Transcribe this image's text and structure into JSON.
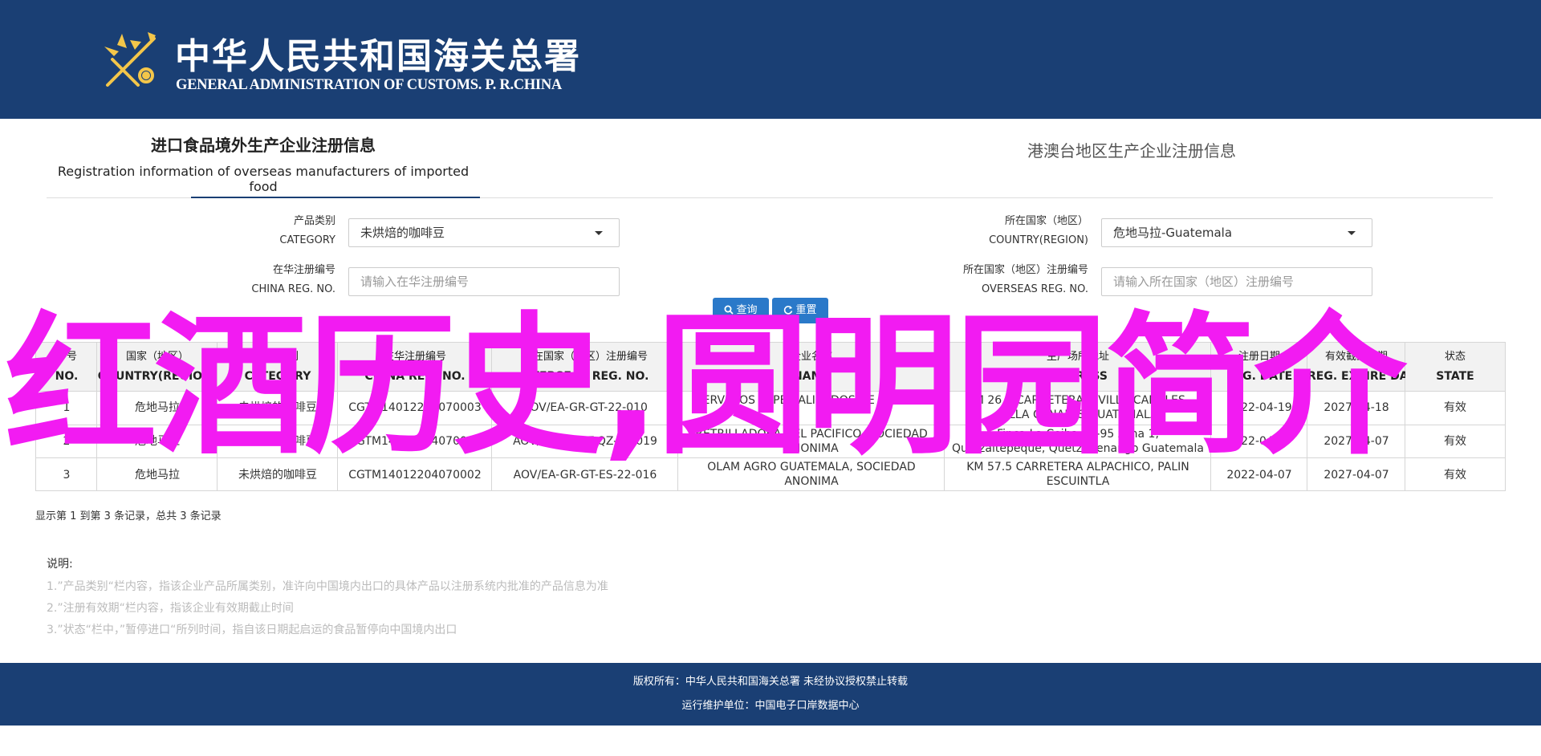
{
  "header": {
    "title_cn": "中华人民共和国海关总署",
    "title_en": "GENERAL ADMINISTRATION OF CUSTOMS. P. R.CHINA",
    "emblem_icon": "customs-emblem-icon"
  },
  "tabs": [
    {
      "label_cn": "进口食品境外生产企业注册信息",
      "label_en": "Registration information of overseas manufacturers of imported food"
    },
    {
      "label_cn": "港澳台地区生产企业注册信息"
    }
  ],
  "form": {
    "category": {
      "label_cn": "产品类别",
      "label_en": "CATEGORY",
      "value": "未烘焙的咖啡豆"
    },
    "country": {
      "label_cn": "所在国家（地区）",
      "label_en": "COUNTRY(REGION)",
      "value": "危地马拉-Guatemala"
    },
    "china_reg": {
      "label_cn": "在华注册编号",
      "label_en": "CHINA REG. NO.",
      "placeholder": "请输入在华注册编号"
    },
    "overseas_reg": {
      "label_cn": "所在国家（地区）注册编号",
      "label_en": "OVERSEAS REG. NO.",
      "placeholder": "请输入所在国家（地区）注册编号"
    },
    "search_label": "查询",
    "reset_label": "重置"
  },
  "table": {
    "headers": [
      {
        "cn": "序号",
        "en": "NO."
      },
      {
        "cn": "国家（地区）",
        "en": "COUNTRY(REGION)"
      },
      {
        "cn": "产品类别",
        "en": "CATEGORY"
      },
      {
        "cn": "在华注册编号",
        "en": "CHINA REG. NO."
      },
      {
        "cn": "所在国家（地区）注册编号",
        "en": "OVERSEAS REG. NO."
      },
      {
        "cn": "企业名称",
        "en": "NAME"
      },
      {
        "cn": "生产场所地址",
        "en": "ADDRESS"
      },
      {
        "cn": "注册日期",
        "en": "REG. DATE"
      },
      {
        "cn": "有效截止日期",
        "en": "REG. EXPIRE DATE"
      },
      {
        "cn": "状态",
        "en": "STATE"
      }
    ],
    "rows": [
      [
        "1",
        "危地马拉",
        "未烘焙的咖啡豆",
        "CGTM14012204070003",
        "AOV/EA-GR-GT-22-010",
        "SERVICIOS ESPECIALIZADOS DE AFIANZA",
        "KM 26.5 CARRETERA A VILLA CANALES, VILLA CANALES GUATEMALA",
        "2022-04-19",
        "2027-04-18",
        "有效"
      ],
      [
        "2",
        "危地马拉",
        "未烘焙的咖啡豆",
        "CGTM14012204070001",
        "AOV/ET-GR-GT-QZ-22-019",
        "RETRILLADORA DEL PACIFICO, SOCIEDAD ANONIMA",
        "Finca La Ceiba 25-95 zona 1, Quetzaltepeque, Quetzaltenango Guatemala",
        "2022-04-07",
        "2027-04-07",
        "有效"
      ],
      [
        "3",
        "危地马拉",
        "未烘焙的咖啡豆",
        "CGTM14012204070002",
        "AOV/EA-GR-GT-ES-22-016",
        "OLAM AGRO GUATEMALA, SOCIEDAD ANONIMA",
        "KM 57.5 CARRETERA ALPACHICO, PALIN ESCUINTLA",
        "2022-04-07",
        "2027-04-07",
        "有效"
      ]
    ]
  },
  "pager_text": "显示第 1 到第 3 条记录，总共 3 条记录",
  "notes": {
    "title": "说明:",
    "items": [
      "1.”产品类别“栏内容，指该企业产品所属类别，准许向中国境内出口的具体产品以注册系统内批准的产品信息为准",
      "2.”注册有效期“栏内容，指该企业有效期截止时间",
      "3.”状态“栏中，”暂停进口“所列时间，指自该日期起启运的食品暂停向中国境内出口"
    ]
  },
  "overlay_text": "红酒历史,圆明园简介",
  "footer": {
    "copyright": "版权所有：中华人民共和国海关总署 未经协议授权禁止转载",
    "maintainer": "运行维护单位：中国电子口岸数据中心"
  },
  "colors": {
    "brand": "#1a3f74",
    "button": "#2a79c9",
    "overlay": "#f21bf2"
  }
}
